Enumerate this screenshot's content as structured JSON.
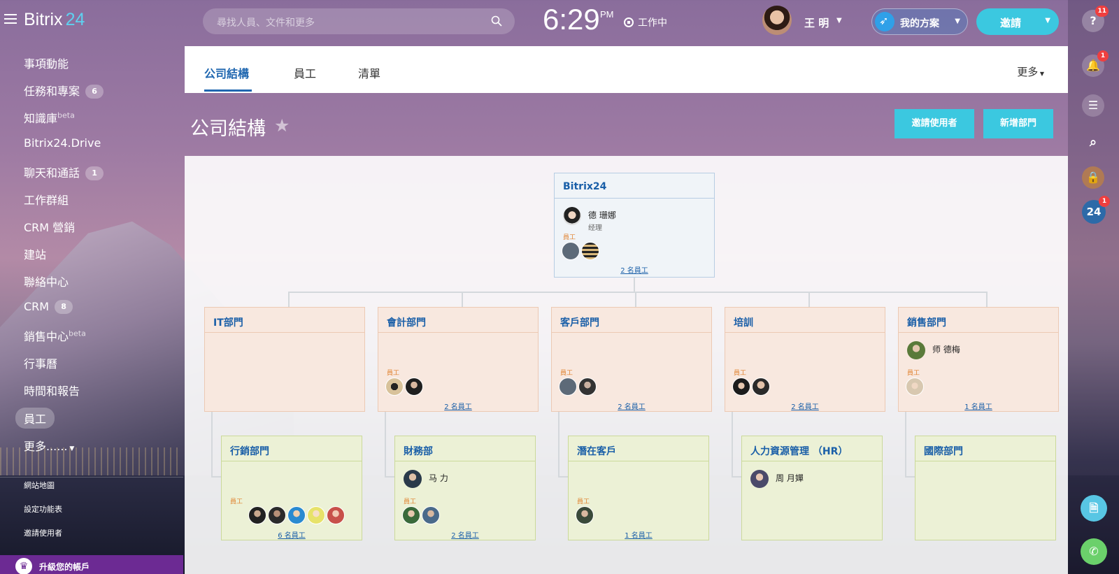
{
  "logo": {
    "name": "Bitrix",
    "num": "24"
  },
  "search": {
    "placeholder": "尋找人員、文件和更多"
  },
  "clock": {
    "time": "6:29",
    "ampm": "PM"
  },
  "status": {
    "label": "工作中"
  },
  "user": {
    "name": "王 明"
  },
  "plan": {
    "label": "我的方案"
  },
  "invite": {
    "label": "邀請"
  },
  "sidebar": {
    "items": [
      {
        "label": "事項動能"
      },
      {
        "label": "任務和專案",
        "count": "6"
      },
      {
        "label": "知識庫",
        "sup": "beta"
      },
      {
        "label": "Bitrix24.Drive"
      },
      {
        "label": "聊天和通話",
        "count": "1"
      },
      {
        "label": "工作群組"
      },
      {
        "label": "CRM 營銷"
      },
      {
        "label": "建站"
      },
      {
        "label": "聯絡中心"
      },
      {
        "label": "CRM",
        "count": "8"
      },
      {
        "label": "銷售中心",
        "sup": "beta"
      },
      {
        "label": "行事曆"
      },
      {
        "label": "時間和報告"
      },
      {
        "label": "員工"
      },
      {
        "label": "更多......"
      }
    ],
    "bottom": [
      {
        "label": "網站地圖"
      },
      {
        "label": "設定功能表"
      },
      {
        "label": "邀請使用者"
      }
    ],
    "upgrade": "升級您的帳戶"
  },
  "rail": {
    "help_badge": "11",
    "bell_badge": "1",
    "b24_label": "24",
    "b24_badge": "1"
  },
  "tabs": [
    {
      "label": "公司結構"
    },
    {
      "label": "員工"
    },
    {
      "label": "清單"
    }
  ],
  "more_tab": "更多",
  "page": {
    "title": "公司結構",
    "invite_users": "邀請使用者",
    "add_department": "新增部門"
  },
  "org": {
    "employees_label": "員工",
    "root": {
      "name": "Bitrix24",
      "manager": "德 珊娜",
      "manager_title": "经理",
      "count": "2 名員工"
    },
    "depts": [
      {
        "name": "IT部門",
        "count": ""
      },
      {
        "name": "會計部門",
        "count": "2 名員工"
      },
      {
        "name": "客戶部門",
        "count": "2 名員工"
      },
      {
        "name": "培訓",
        "count": "2 名員工"
      },
      {
        "name": "銷售部門",
        "manager": "师 德梅",
        "count": "1 名員工"
      }
    ],
    "subs": [
      {
        "name": "行銷部門",
        "count": "6 名員工"
      },
      {
        "name": "財務部",
        "manager": "马 力",
        "count": "2 名員工"
      },
      {
        "name": "潛在客戶",
        "count": "1 名員工"
      },
      {
        "name": "人力資源管理 （HR）",
        "manager": "周 月嬋",
        "count": ""
      },
      {
        "name": "國際部門",
        "count": ""
      }
    ]
  },
  "colors": {
    "accent": "#3bc8e0",
    "link": "#1a5fa8",
    "brand_num": "#5ed1f0"
  }
}
